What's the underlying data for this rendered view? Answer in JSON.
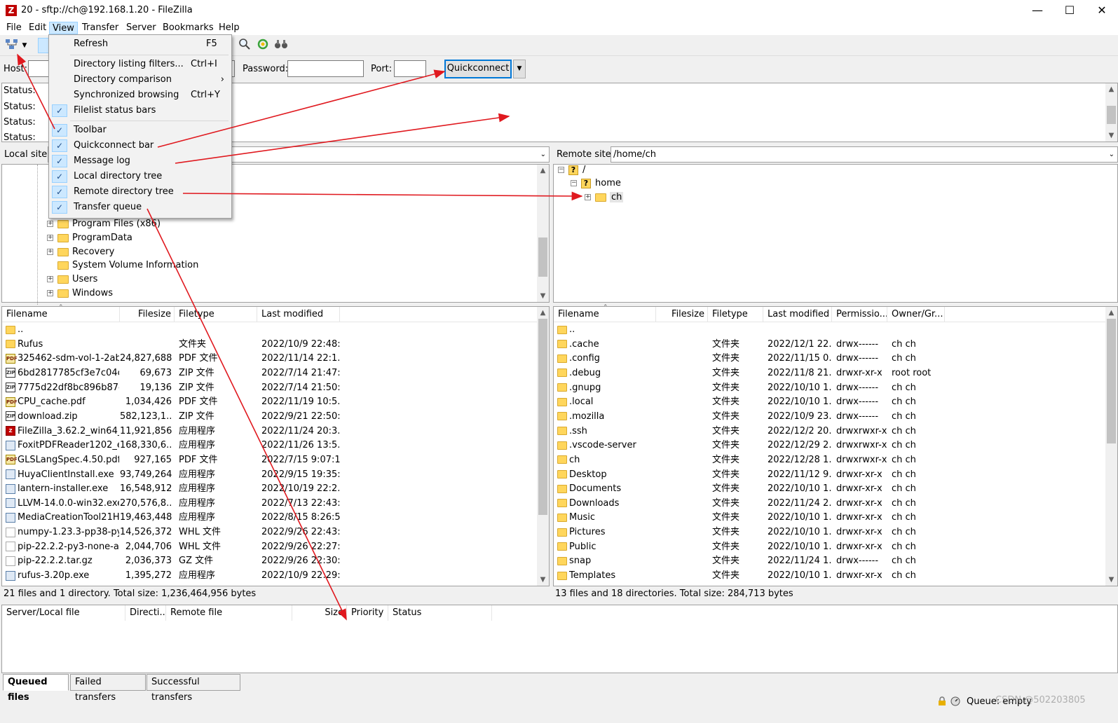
{
  "window": {
    "title": "20 - sftp://ch@192.168.1.20 - FileZilla",
    "app_icon": "Z",
    "minimize": "—",
    "maximize": "☐",
    "close": "✕"
  },
  "menubar": [
    "File",
    "Edit",
    "View",
    "Transfer",
    "Server",
    "Bookmarks",
    "Help"
  ],
  "quickconnect": {
    "host_label": "Host:",
    "host_value": "",
    "password_label": "Password:",
    "password_value": "",
    "port_label": "Port:",
    "port_value": "",
    "button_label": "Quickconnect",
    "dropdown_glyph": "▼"
  },
  "message_log": [
    "Status:",
    "Status:",
    "Status:",
    "Status:"
  ],
  "view_menu": [
    {
      "label": "Refresh",
      "shortcut": "F5",
      "checked": false
    },
    {
      "label": "Directory listing filters...",
      "shortcut": "Ctrl+I",
      "checked": false
    },
    {
      "label": "Directory comparison",
      "shortcut": "",
      "checked": false,
      "submenu": "›"
    },
    {
      "label": "Synchronized browsing",
      "shortcut": "Ctrl+Y",
      "checked": false
    },
    {
      "label": "Filelist status bars",
      "shortcut": "",
      "checked": true
    },
    {
      "label": "Toolbar",
      "shortcut": "",
      "checked": true
    },
    {
      "label": "Quickconnect bar",
      "shortcut": "",
      "checked": true
    },
    {
      "label": "Message log",
      "shortcut": "",
      "checked": true
    },
    {
      "label": "Local directory tree",
      "shortcut": "",
      "checked": true
    },
    {
      "label": "Remote directory tree",
      "shortcut": "",
      "checked": true
    },
    {
      "label": "Transfer queue",
      "shortcut": "",
      "checked": true
    }
  ],
  "check_glyph": "✓",
  "local": {
    "site_label": "Local site:",
    "site_value": "",
    "tree": [
      "Program Files (x86)",
      "ProgramData",
      "Recovery",
      "System Volume Information",
      "Users",
      "Windows"
    ],
    "columns": [
      "Filename",
      "Filesize",
      "Filetype",
      "Last modified"
    ],
    "files": [
      {
        "name": "..",
        "size": "",
        "type": "",
        "modified": "",
        "icon": "folder"
      },
      {
        "name": "Rufus",
        "size": "",
        "type": "文件夹",
        "modified": "2022/10/9 22:48:...",
        "icon": "folder"
      },
      {
        "name": "325462-sdm-vol-1-2ab...",
        "size": "24,827,688",
        "type": "PDF 文件",
        "modified": "2022/11/14 22:1...",
        "icon": "pdf"
      },
      {
        "name": "6bd2817785cf3e7c04c8...",
        "size": "69,673",
        "type": "ZIP 文件",
        "modified": "2022/7/14 21:47:...",
        "icon": "zip"
      },
      {
        "name": "7775d22df8bc896b87c...",
        "size": "19,136",
        "type": "ZIP 文件",
        "modified": "2022/7/14 21:50:...",
        "icon": "zip"
      },
      {
        "name": "CPU_cache.pdf",
        "size": "1,034,426",
        "type": "PDF 文件",
        "modified": "2022/11/19 10:5...",
        "icon": "pdf"
      },
      {
        "name": "download.zip",
        "size": "582,123,1...",
        "type": "ZIP 文件",
        "modified": "2022/9/21 22:50:...",
        "icon": "zip"
      },
      {
        "name": "FileZilla_3.62.2_win64_s...",
        "size": "11,921,856",
        "type": "应用程序",
        "modified": "2022/11/24 20:3...",
        "icon": "fz"
      },
      {
        "name": "FoxitPDFReader1202_e...",
        "size": "168,330,6...",
        "type": "应用程序",
        "modified": "2022/11/26 13:5...",
        "icon": "exe"
      },
      {
        "name": "GLSLangSpec.4.50.pdf",
        "size": "927,165",
        "type": "PDF 文件",
        "modified": "2022/7/15 9:07:18",
        "icon": "pdf"
      },
      {
        "name": "HuyaClientInstall.exe",
        "size": "93,749,264",
        "type": "应用程序",
        "modified": "2022/9/15 19:35:...",
        "icon": "exe"
      },
      {
        "name": "lantern-installer.exe",
        "size": "16,548,912",
        "type": "应用程序",
        "modified": "2022/10/19 22:2...",
        "icon": "exe"
      },
      {
        "name": "LLVM-14.0.0-win32.exe",
        "size": "270,576,8...",
        "type": "应用程序",
        "modified": "2022/7/13 22:43:...",
        "icon": "exe"
      },
      {
        "name": "MediaCreationTool21H...",
        "size": "19,463,448",
        "type": "应用程序",
        "modified": "2022/8/15 8:26:52",
        "icon": "exe"
      },
      {
        "name": "numpy-1.23.3-pp38-py...",
        "size": "14,526,372",
        "type": "WHL 文件",
        "modified": "2022/9/26 22:43:...",
        "icon": "doc"
      },
      {
        "name": "pip-22.2.2-py3-none-an...",
        "size": "2,044,706",
        "type": "WHL 文件",
        "modified": "2022/9/26 22:27:...",
        "icon": "doc"
      },
      {
        "name": "pip-22.2.2.tar.gz",
        "size": "2,036,373",
        "type": "GZ 文件",
        "modified": "2022/9/26 22:30:...",
        "icon": "doc"
      },
      {
        "name": "rufus-3.20p.exe",
        "size": "1,395,272",
        "type": "应用程序",
        "modified": "2022/10/9 22:29:...",
        "icon": "exe"
      }
    ],
    "status": "21 files and 1 directory. Total size: 1,236,464,956 bytes"
  },
  "remote": {
    "site_label": "Remote site:",
    "site_value": "/home/ch",
    "tree": [
      "/",
      "home",
      "ch"
    ],
    "columns": [
      "Filename",
      "Filesize",
      "Filetype",
      "Last modified",
      "Permissio...",
      "Owner/Gr..."
    ],
    "files": [
      {
        "name": "..",
        "type": "",
        "modified": "",
        "perm": "",
        "owner": ""
      },
      {
        "name": ".cache",
        "type": "文件夹",
        "modified": "2022/12/1 22...",
        "perm": "drwx------",
        "owner": "ch ch"
      },
      {
        "name": ".config",
        "type": "文件夹",
        "modified": "2022/11/15 0...",
        "perm": "drwx------",
        "owner": "ch ch"
      },
      {
        "name": ".debug",
        "type": "文件夹",
        "modified": "2022/11/8 21...",
        "perm": "drwxr-xr-x",
        "owner": "root root"
      },
      {
        "name": ".gnupg",
        "type": "文件夹",
        "modified": "2022/10/10 1...",
        "perm": "drwx------",
        "owner": "ch ch"
      },
      {
        "name": ".local",
        "type": "文件夹",
        "modified": "2022/10/10 1...",
        "perm": "drwx------",
        "owner": "ch ch"
      },
      {
        "name": ".mozilla",
        "type": "文件夹",
        "modified": "2022/10/9 23...",
        "perm": "drwx------",
        "owner": "ch ch"
      },
      {
        "name": ".ssh",
        "type": "文件夹",
        "modified": "2022/12/2 20...",
        "perm": "drwxrwxr-x",
        "owner": "ch ch"
      },
      {
        "name": ".vscode-server",
        "type": "文件夹",
        "modified": "2022/12/29 2...",
        "perm": "drwxrwxr-x",
        "owner": "ch ch"
      },
      {
        "name": "ch",
        "type": "文件夹",
        "modified": "2022/12/28 1...",
        "perm": "drwxrwxr-x",
        "owner": "ch ch"
      },
      {
        "name": "Desktop",
        "type": "文件夹",
        "modified": "2022/11/12 9...",
        "perm": "drwxr-xr-x",
        "owner": "ch ch"
      },
      {
        "name": "Documents",
        "type": "文件夹",
        "modified": "2022/10/10 1...",
        "perm": "drwxr-xr-x",
        "owner": "ch ch"
      },
      {
        "name": "Downloads",
        "type": "文件夹",
        "modified": "2022/11/24 2...",
        "perm": "drwxr-xr-x",
        "owner": "ch ch"
      },
      {
        "name": "Music",
        "type": "文件夹",
        "modified": "2022/10/10 1...",
        "perm": "drwxr-xr-x",
        "owner": "ch ch"
      },
      {
        "name": "Pictures",
        "type": "文件夹",
        "modified": "2022/10/10 1...",
        "perm": "drwxr-xr-x",
        "owner": "ch ch"
      },
      {
        "name": "Public",
        "type": "文件夹",
        "modified": "2022/10/10 1...",
        "perm": "drwxr-xr-x",
        "owner": "ch ch"
      },
      {
        "name": "snap",
        "type": "文件夹",
        "modified": "2022/11/24 1...",
        "perm": "drwx------",
        "owner": "ch ch"
      },
      {
        "name": "Templates",
        "type": "文件夹",
        "modified": "2022/10/10 1...",
        "perm": "drwxr-xr-x",
        "owner": "ch ch"
      }
    ],
    "status": "13 files and 18 directories. Total size: 284,713 bytes"
  },
  "queue": {
    "columns": [
      "Server/Local file",
      "Directi...",
      "Remote file",
      "Size",
      "Priority",
      "Status"
    ],
    "tabs": [
      "Queued files",
      "Failed transfers",
      "Successful transfers"
    ],
    "status_label": "Queue: empty"
  },
  "watermark": "CSDN @502203805",
  "colors": {
    "annotation_arrow": "#e0191f",
    "selection": "#cce8ff",
    "folder": "#ffd65c",
    "focus_border": "#0078d7"
  }
}
